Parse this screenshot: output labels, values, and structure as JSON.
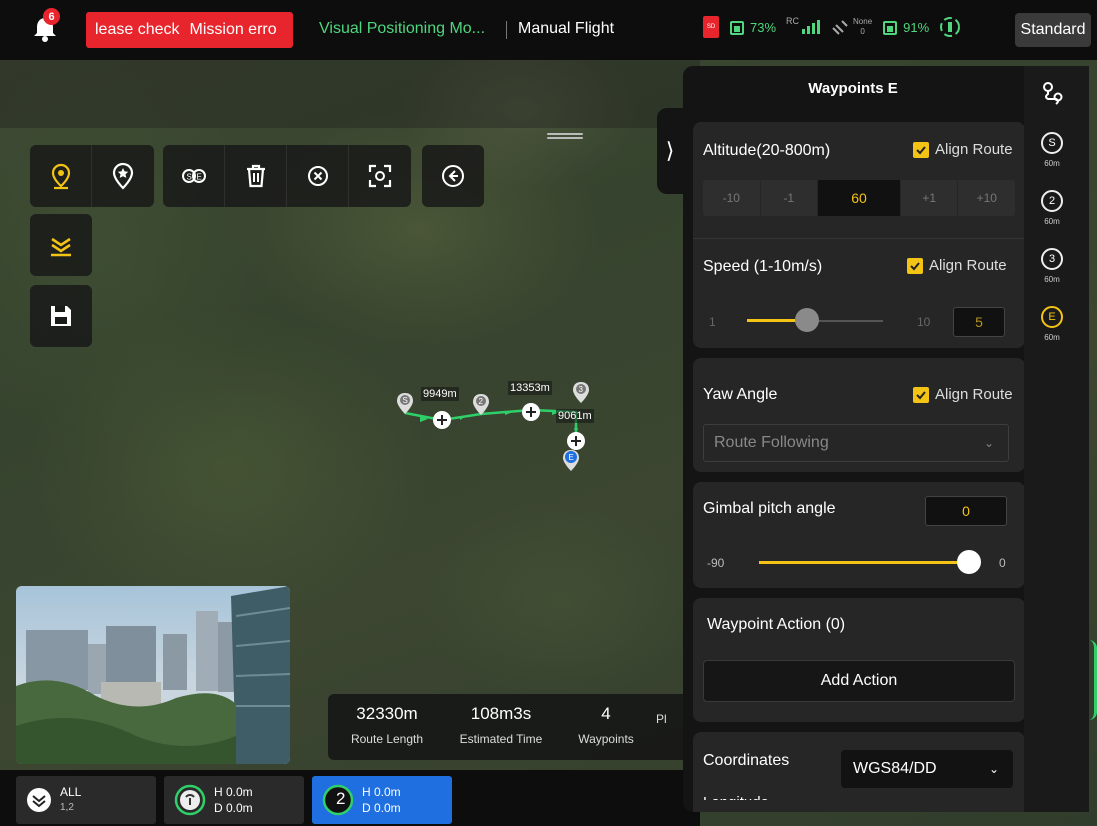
{
  "topbar": {
    "notification_count": "6",
    "alert_messages": [
      "lease check",
      "Mission erro"
    ],
    "positioning_mode": "Visual Positioning Mo...",
    "flight_mode": "Manual Flight",
    "sd_label": "SD",
    "aircraft_battery": "73%",
    "rc_label": "RC",
    "satellite_label": "None",
    "satellite_count": "0",
    "rc_battery": "91%",
    "profile_button": "Standard"
  },
  "toolbar": {
    "icons": [
      "waypoint-pin-icon",
      "star-pin-icon",
      "start-end-icon",
      "trash-icon",
      "close-circle-icon",
      "focus-icon",
      "back-arrow-icon"
    ],
    "side_icons": [
      "takeoff-icon",
      "save-icon"
    ]
  },
  "route": {
    "distances": [
      "9949m",
      "13353m",
      "9061m"
    ],
    "waypoints": [
      "S",
      "2",
      "3",
      "E"
    ]
  },
  "stats": {
    "route_length_value": "32330m",
    "route_length_label": "Route Length",
    "estimated_time_value": "108m3s",
    "estimated_time_label": "Estimated Time",
    "waypoints_value": "4",
    "waypoints_label": "Waypoints",
    "cut_label": "Pl"
  },
  "drone_bar": {
    "group_label": "ALL",
    "group_sub": "1,2",
    "drone1_h": "H 0.0m",
    "drone1_d": "D 0.0m",
    "drone2_num": "2",
    "drone2_h": "H 0.0m",
    "drone2_d": "D 0.0m"
  },
  "panel": {
    "title": "Waypoints E",
    "altitude": {
      "label": "Altitude(20-800m)",
      "align_label": "Align Route",
      "steps": [
        "-10",
        "-1",
        "60",
        "+1",
        "+10"
      ]
    },
    "speed": {
      "label": "Speed (1-10m/s)",
      "align_label": "Align Route",
      "min": "1",
      "max": "10",
      "value": "5",
      "fraction": 0.44
    },
    "yaw": {
      "label": "Yaw Angle",
      "align_label": "Align Route",
      "mode": "Route Following"
    },
    "gimbal": {
      "label": "Gimbal pitch angle",
      "value": "0",
      "min": "-90",
      "max": "0",
      "fraction": 1.0
    },
    "waypoint_action": {
      "label": "Waypoint Action (0)",
      "button": "Add Action"
    },
    "coordinates": {
      "label": "Coordinates",
      "system": "WGS84/DD",
      "next_label": "Longitude"
    }
  },
  "wp_sidebar": {
    "items": [
      {
        "label": "S",
        "alt": "60m",
        "active": false
      },
      {
        "label": "2",
        "alt": "60m",
        "active": false
      },
      {
        "label": "3",
        "alt": "60m",
        "active": false
      },
      {
        "label": "E",
        "alt": "60m",
        "active": true
      }
    ]
  },
  "colors": {
    "accent_yellow": "#f3c315",
    "alert_red": "#e8252c",
    "status_green": "#4fd67e",
    "route_green": "#2fd06a",
    "selected_blue": "#1f6fe0"
  }
}
